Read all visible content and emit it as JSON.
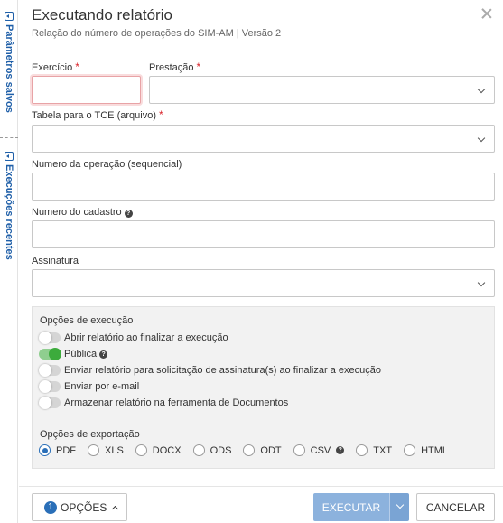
{
  "sidebar": {
    "tabs": [
      {
        "label": "Parâmetros salvos"
      },
      {
        "label": "Execuções recentes"
      }
    ]
  },
  "header": {
    "title": "Executando relatório",
    "subtitle": "Relação do número de operações do SIM-AM | Versão 2"
  },
  "form": {
    "exercicio": {
      "label": "Exercício",
      "required_mark": "*",
      "value": ""
    },
    "prestacao": {
      "label": "Prestação",
      "required_mark": "*",
      "value": ""
    },
    "tabela": {
      "label": "Tabela para o TCE (arquivo)",
      "required_mark": "*",
      "value": ""
    },
    "numero_operacao": {
      "label": "Numero da operação (sequencial)",
      "value": ""
    },
    "numero_cadastro": {
      "label": "Numero do cadastro",
      "help_icon": "question-icon",
      "value": ""
    },
    "assinatura": {
      "label": "Assinatura",
      "value": ""
    }
  },
  "execution_options": {
    "title": "Opções de execução",
    "toggles": [
      {
        "label": "Abrir relatório ao finalizar a execução",
        "on": false
      },
      {
        "label": "Pública",
        "on": true,
        "help_icon": "question-icon"
      },
      {
        "label": "Enviar relatório para solicitação de assinatura(s) ao finalizar a execução",
        "on": false
      },
      {
        "label": "Enviar por e-mail",
        "on": false
      },
      {
        "label": "Armazenar relatório na ferramenta de Documentos",
        "on": false
      }
    ]
  },
  "export_options": {
    "title": "Opções de exportação",
    "selected": "PDF",
    "formats": [
      "PDF",
      "XLS",
      "DOCX",
      "ODS",
      "ODT",
      "CSV",
      "TXT",
      "HTML"
    ],
    "csv_help_icon": "question-icon"
  },
  "footer": {
    "options_badge": "1",
    "options_label": "OPÇÕES",
    "execute_label": "EXECUTAR",
    "cancel_label": "CANCELAR"
  },
  "colors": {
    "primary": "#2a6fb8",
    "required": "#d9242b",
    "toggle_on": "#3cab3c",
    "execute_button": "#8cb2dd"
  }
}
